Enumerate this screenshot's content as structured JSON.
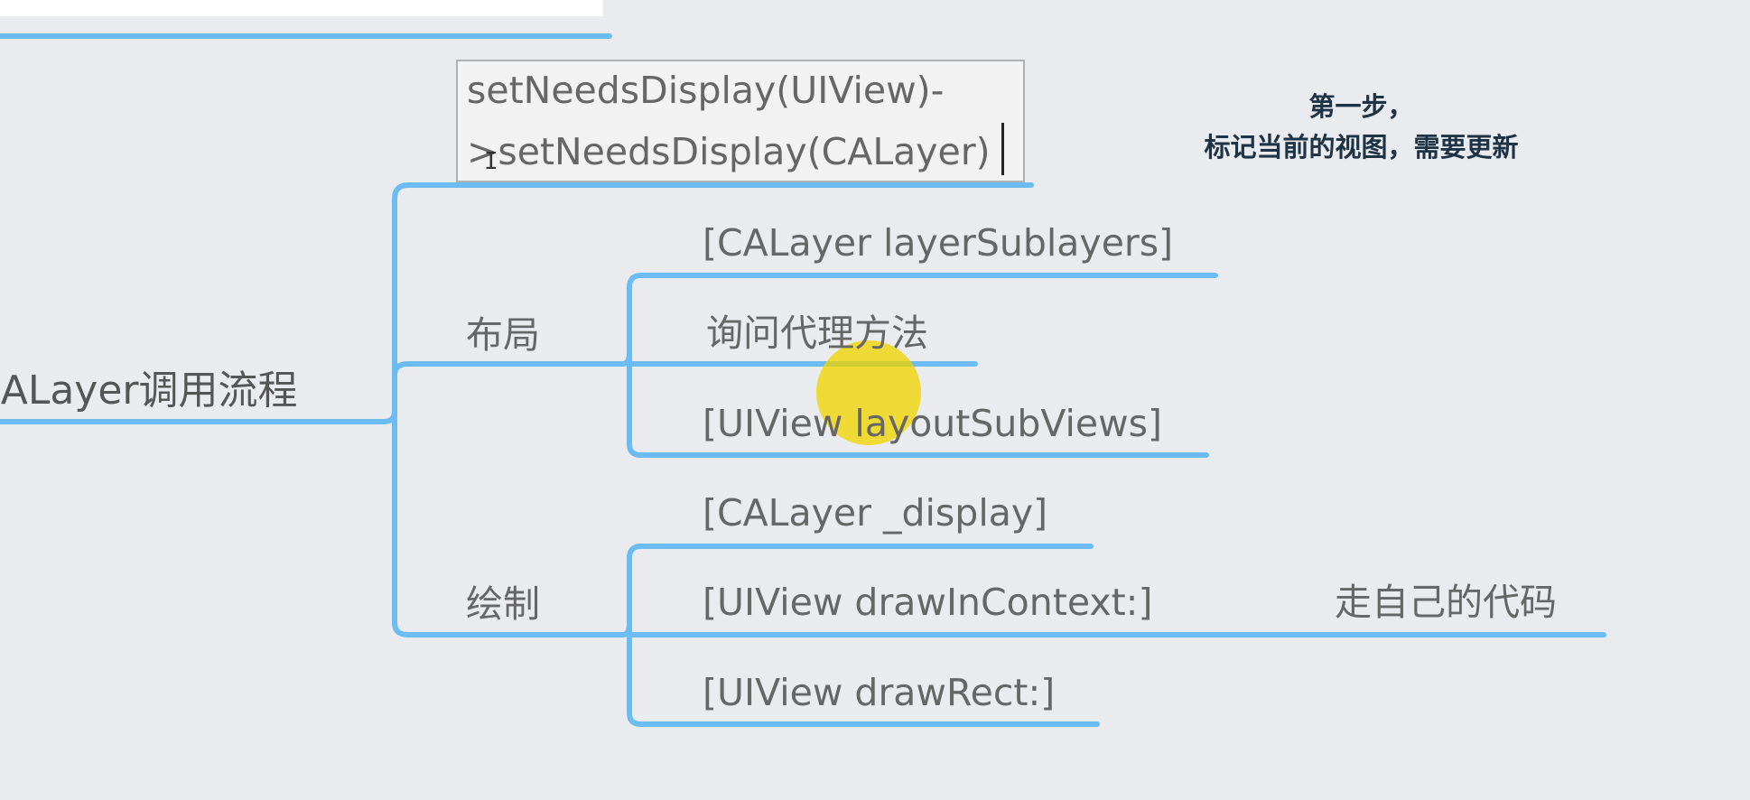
{
  "mindmap": {
    "root": "CALayer调用流程",
    "editing_node": {
      "line1": "setNeedsDisplay(UIView)-",
      "line2": ">setNeedsDisplay(CALayer)"
    },
    "branches": {
      "layout": {
        "label": "布局",
        "children": [
          "[CALayer layerSublayers]",
          "询问代理方法",
          "[UIView layoutSubViews]"
        ]
      },
      "draw": {
        "label": "绘制",
        "children": [
          "[CALayer _display]",
          "[UIView drawInContext:]",
          "[UIView drawRect:]"
        ],
        "drawincontext_child": "走自己的代码"
      }
    }
  },
  "annotation": {
    "line1": "第一步，",
    "line2": "标记当前的视图，需要更新"
  },
  "colors": {
    "background": "#eaebef",
    "branch_line": "#6bbcf2",
    "node_text": "#666666",
    "annotation_text": "#1f3346",
    "pointer_highlight": "#f0d400"
  }
}
